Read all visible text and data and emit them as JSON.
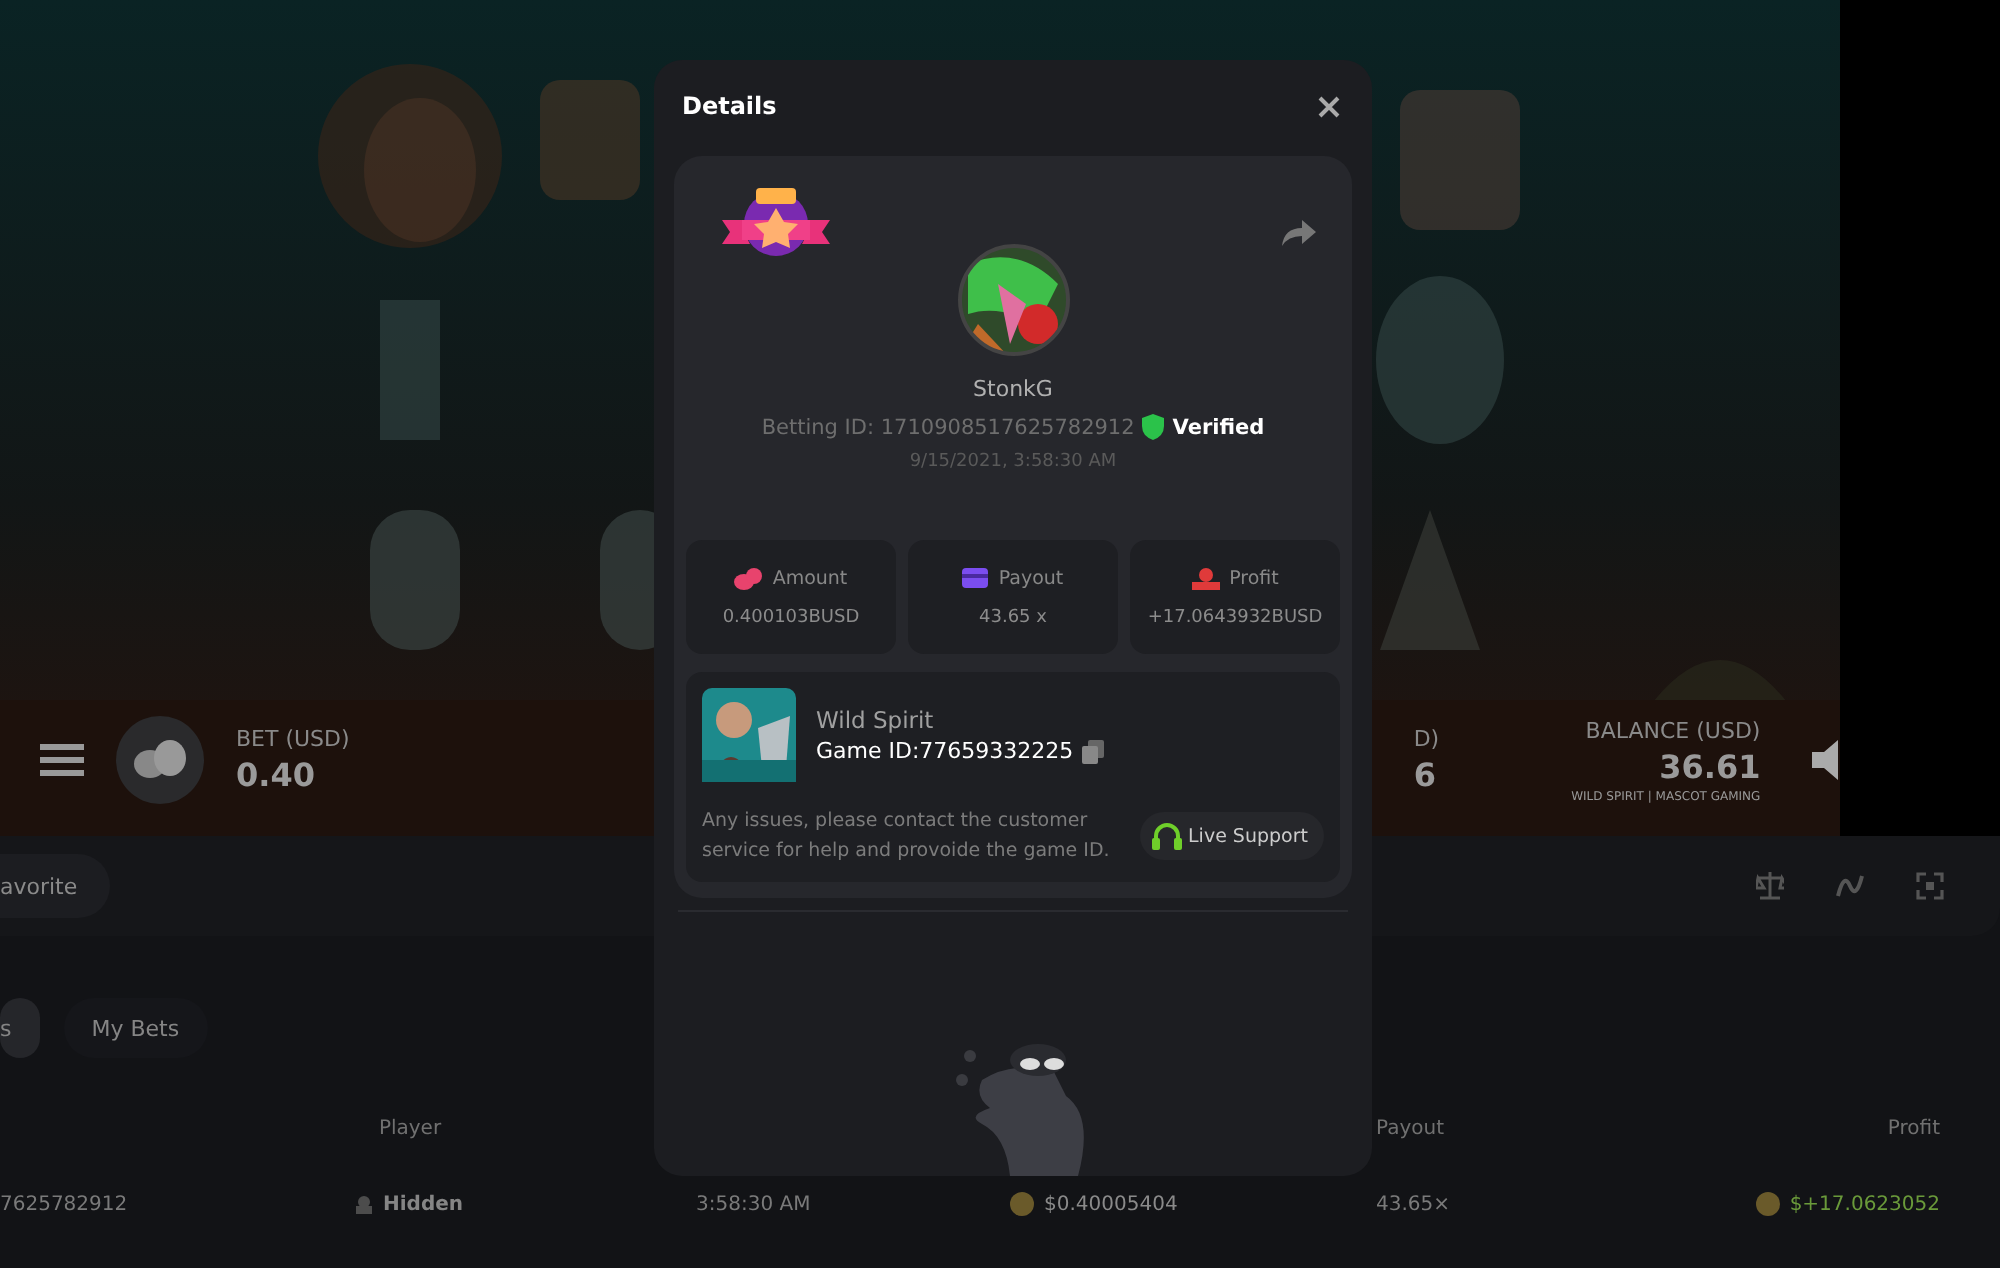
{
  "game_bar": {
    "bet_label": "BET (USD)",
    "bet_value": "0.40",
    "cut_label": "D)",
    "cut_value": "6",
    "balance_label": "BALANCE (USD)",
    "balance_value": "36.61",
    "credit": "WILD SPIRIT | MASCOT GAMING"
  },
  "toolbar": {
    "favorite": "avorite"
  },
  "tabs": [
    {
      "label": "s",
      "selected": true
    },
    {
      "label": "My Bets",
      "selected": false
    }
  ],
  "table": {
    "columns": [
      {},
      {
        "label": "Player"
      },
      {},
      {},
      {
        "label": "Payout"
      },
      {
        "label": "Profit"
      }
    ],
    "rows": [
      {
        "cells": [
          "7625782912",
          "Hidden",
          "3:58:30 AM",
          "$0.40005404",
          "43.65×",
          "$+17.0623052"
        ]
      }
    ]
  },
  "modal": {
    "title": "Details",
    "player": "StonkG",
    "betting_id": "Betting ID: 1710908517625782912",
    "verified": true,
    "verified_label": "Verified",
    "date": "9/15/2021, 3:58:30 AM",
    "stats": [
      {
        "kind": "amount",
        "label": "Amount",
        "value": "0.400103BUSD"
      },
      {
        "kind": "payout",
        "label": "Payout",
        "value": "43.65 x"
      },
      {
        "kind": "profit",
        "label": "Profit",
        "value": "+17.0643932BUSD"
      }
    ],
    "game": {
      "name": "Wild Spirit",
      "game_id": "Game ID:77659332225",
      "note": "Any issues, please contact the customer service for help and provoide the game ID.",
      "support": "Live Support"
    }
  }
}
